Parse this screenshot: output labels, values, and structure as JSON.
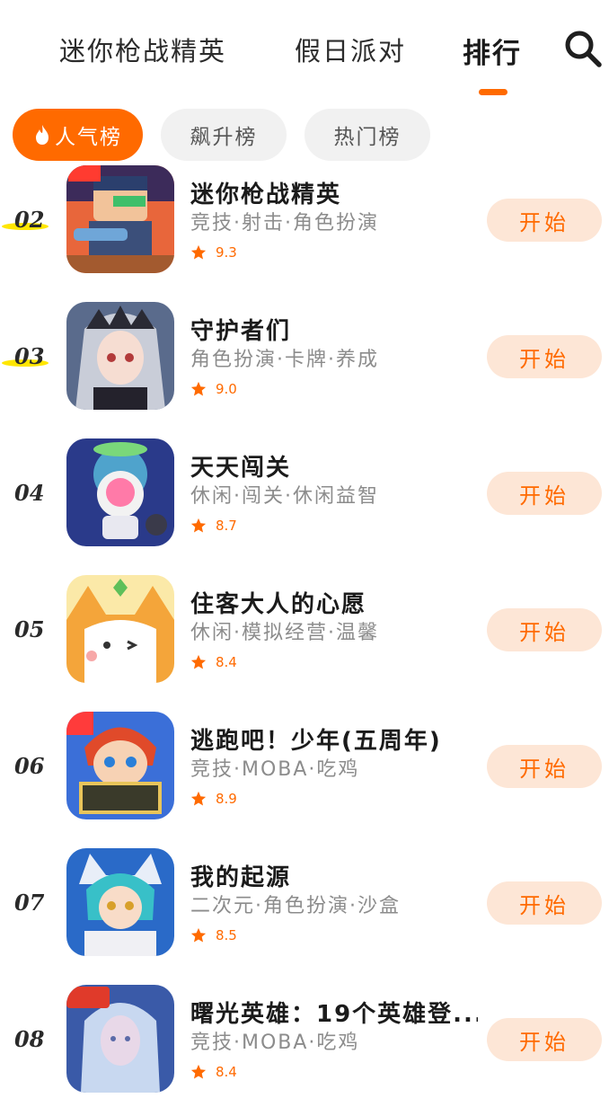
{
  "topnav": {
    "tabs": [
      {
        "label": "迷你枪战精英"
      },
      {
        "label": "假日派对"
      },
      {
        "label": "排行"
      }
    ]
  },
  "chips": [
    {
      "label": "人气榜"
    },
    {
      "label": "飙升榜"
    },
    {
      "label": "热门榜"
    }
  ],
  "colors": {
    "accent": "#ff6a00",
    "button_bg": "#fde6d6",
    "chip_bg": "#f1f1f1",
    "rank_highlight": "#ffe600"
  },
  "list": [
    {
      "rank": "02",
      "title": "迷你枪战精英",
      "tags": "竞技·射击·角色扮演",
      "score": "9.3",
      "button": "开始",
      "icon": "soldier-game-icon"
    },
    {
      "rank": "03",
      "title": "守护者们",
      "tags": "角色扮演·卡牌·养成",
      "score": "9.0",
      "button": "开始",
      "icon": "anime-girl-game-icon"
    },
    {
      "rank": "04",
      "title": "天天闯关",
      "tags": "休闲·闯关·休闲益智",
      "score": "8.7",
      "button": "开始",
      "icon": "astronaut-game-icon"
    },
    {
      "rank": "05",
      "title": "住客大人的心愿",
      "tags": "休闲·模拟经营·温馨",
      "score": "8.4",
      "button": "开始",
      "icon": "cat-game-icon"
    },
    {
      "rank": "06",
      "title": "逃跑吧！少年(五周年)",
      "tags": "竞技·MOBA·吃鸡",
      "score": "8.9",
      "button": "开始",
      "icon": "boy-game-icon"
    },
    {
      "rank": "07",
      "title": "我的起源",
      "tags": "二次元·角色扮演·沙盒",
      "score": "8.5",
      "button": "开始",
      "icon": "fox-girl-game-icon"
    },
    {
      "rank": "08",
      "title": "曙光英雄：19个英雄登...",
      "tags": "竞技·MOBA·吃鸡",
      "score": "8.4",
      "button": "开始",
      "icon": "elf-hero-game-icon"
    }
  ]
}
